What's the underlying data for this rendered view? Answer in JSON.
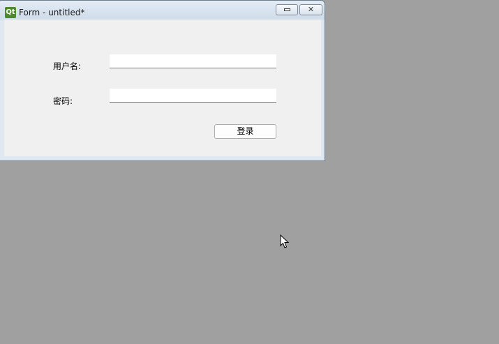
{
  "window": {
    "title": "Form - untitled*",
    "app_icon_text": "Qt",
    "minimize_icon": "minimize-icon",
    "close_icon": "close-icon",
    "close_glyph": "✕"
  },
  "form": {
    "username_label": "用户名:",
    "password_label": "密码:",
    "username_value": "",
    "password_value": "",
    "login_button_label": "登录"
  },
  "colors": {
    "desktop": "#a0a0a0",
    "client_background": "#f0f0f0",
    "qt_brand": "#4d8a2e"
  }
}
